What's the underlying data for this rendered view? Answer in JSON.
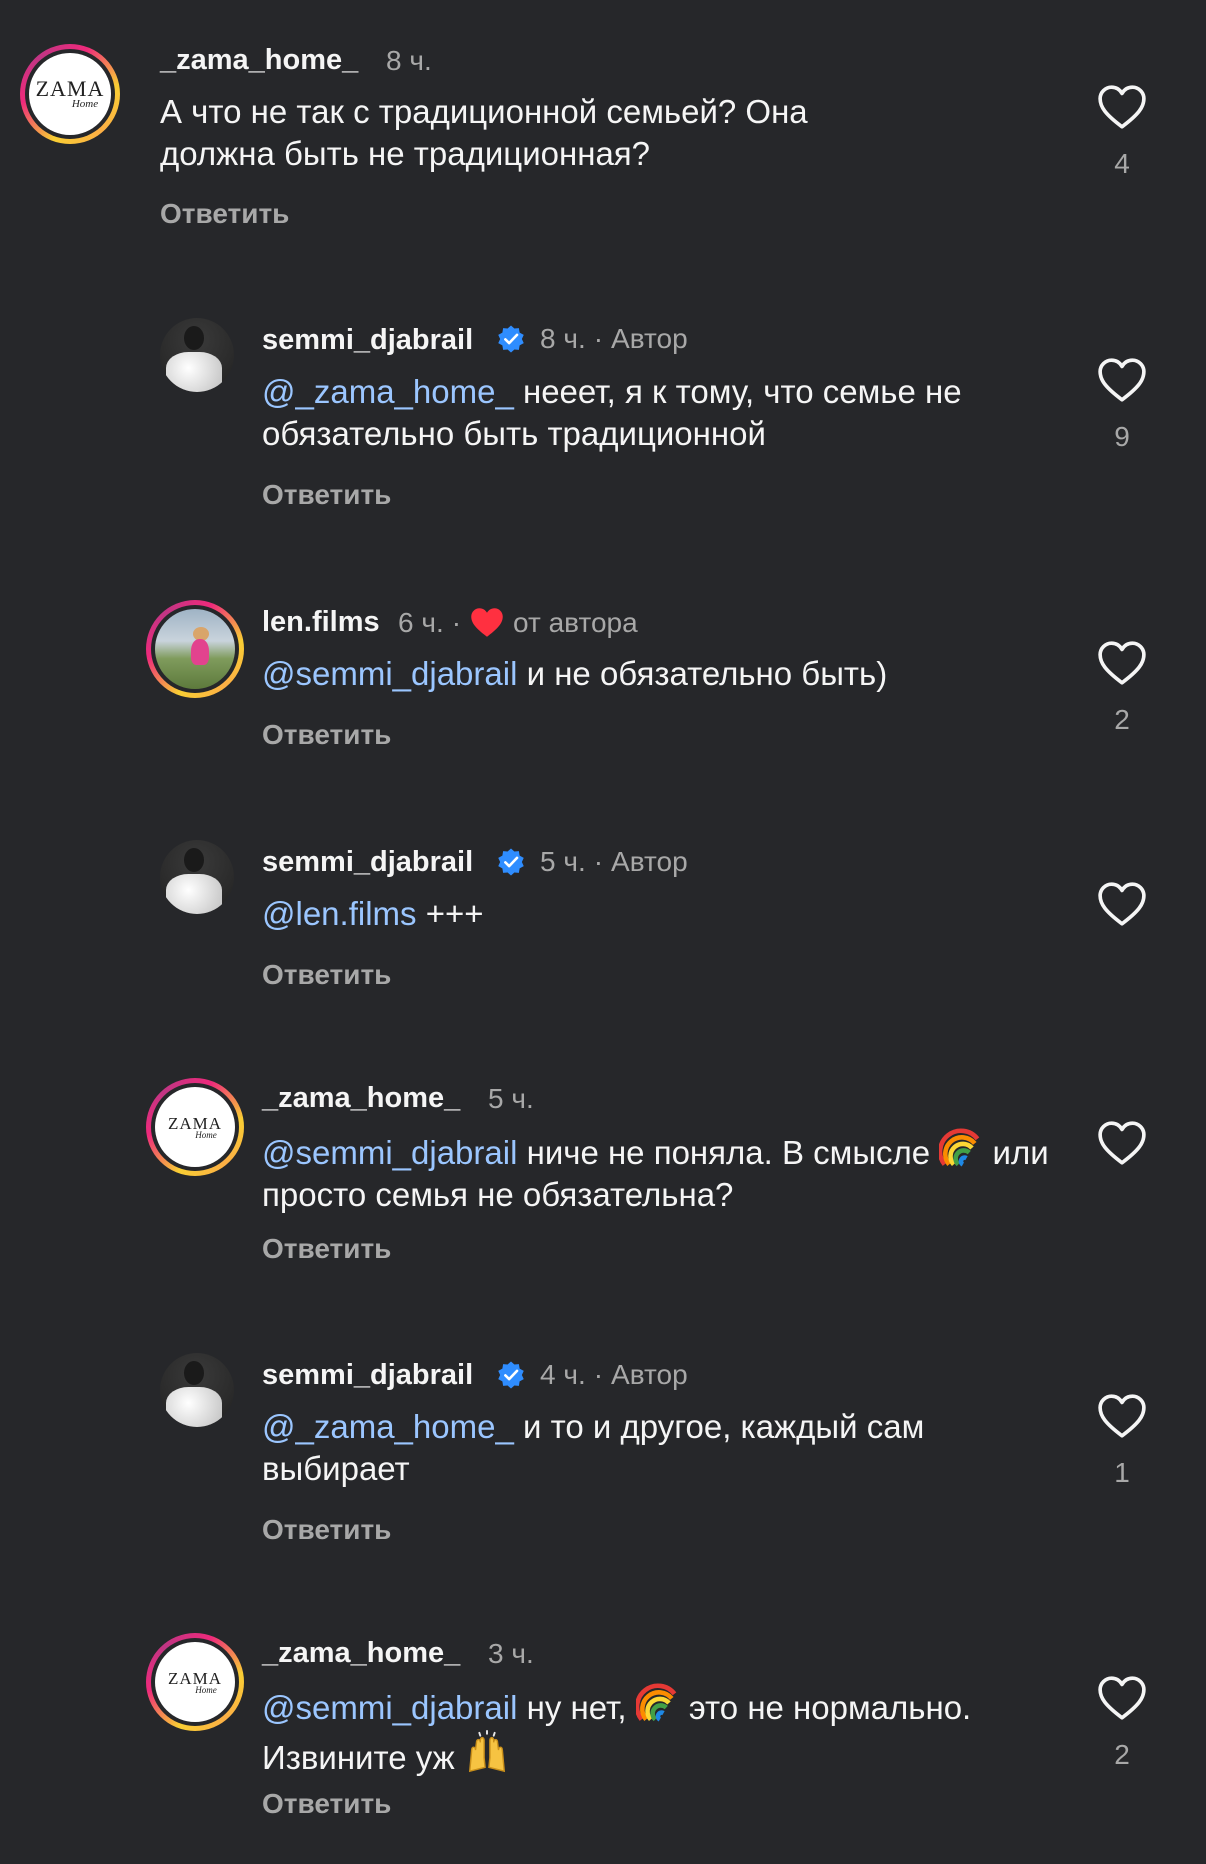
{
  "reply_label": "Ответить",
  "comments": [
    {
      "username": "_zama_home_",
      "time": "8 ч.",
      "text": "А что не так с традиционной семьей? Она должна быть не традиционная?",
      "likes": "4"
    },
    {
      "username": "semmi_djabrail",
      "time": "8 ч.",
      "author": "Автор",
      "mention": "@_zama_home_",
      "text": " нееет, я к тому, что семье не обязательно быть традиционной",
      "likes": "9"
    },
    {
      "username": "len.films",
      "time": "6 ч.",
      "liked_by_author": "от автора",
      "mention": "@semmi_djabrail",
      "text": " и не обязательно быть)",
      "likes": "2"
    },
    {
      "username": "semmi_djabrail",
      "time": "5 ч.",
      "author": "Автор",
      "mention": "@len.films",
      "text": " +++",
      "likes": ""
    },
    {
      "username": "_zama_home_",
      "time": "5 ч.",
      "mention": "@semmi_djabrail",
      "text_a": " ниче не поняла. В смысле ",
      "emoji": "rainbow",
      "text_b": " или просто семья не обязательна?",
      "likes": ""
    },
    {
      "username": "semmi_djabrail",
      "time": "4 ч.",
      "author": "Автор",
      "mention": "@_zama_home_",
      "text": " и то и другое, каждый сам выбирает",
      "likes": "1"
    },
    {
      "username": "_zama_home_",
      "time": "3 ч.",
      "mention": "@semmi_djabrail",
      "text_a": " ну нет, ",
      "emoji": "rainbow",
      "text_b": " это не нормально. Извините уж ",
      "emoji2": "raising-hands",
      "likes": "2"
    }
  ],
  "logo": {
    "main": "ZAMA",
    "sub": "Home"
  },
  "colors": {
    "background": "#26272a",
    "mention": "#9bc6ff",
    "secondary_text": "#a8a8a8",
    "verified": "#2f8dff",
    "heart_red": "#ff3040"
  }
}
